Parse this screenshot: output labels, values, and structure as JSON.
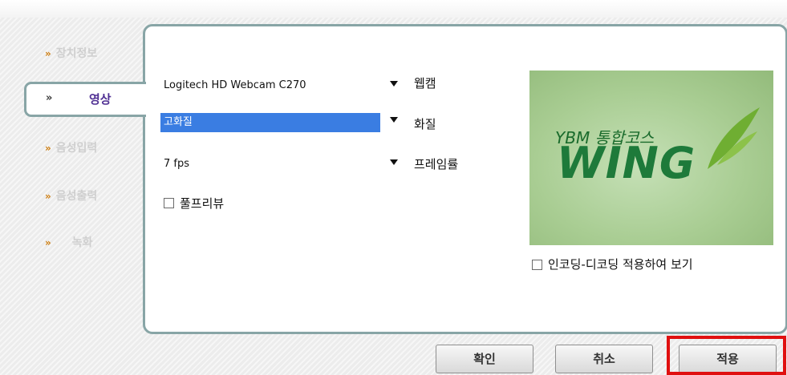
{
  "sidebar": {
    "items": [
      {
        "label": "장치정보"
      },
      {
        "label": "영상"
      },
      {
        "label": "음성입력"
      },
      {
        "label": "음성출력"
      },
      {
        "label": "녹화"
      }
    ],
    "active_index": 1
  },
  "video": {
    "webcam": {
      "value": "Logitech HD Webcam C270",
      "label": "웹캠"
    },
    "quality": {
      "value": "고화질",
      "label": "화질"
    },
    "framerate": {
      "value": "7 fps",
      "label": "프레임률"
    },
    "full_preview": {
      "label": "풀프리뷰",
      "checked": false
    },
    "encoding_preview": {
      "label": "인코딩-디코딩 적용하여 보기",
      "checked": false
    }
  },
  "preview_image": {
    "brand_small": "YBM 통합코스",
    "brand_large": "WING"
  },
  "buttons": {
    "ok": "확인",
    "cancel": "취소",
    "apply": "적용"
  },
  "colors": {
    "accent_border": "#88a5a6",
    "selection": "#3a7de2",
    "highlight": "#e01010"
  }
}
